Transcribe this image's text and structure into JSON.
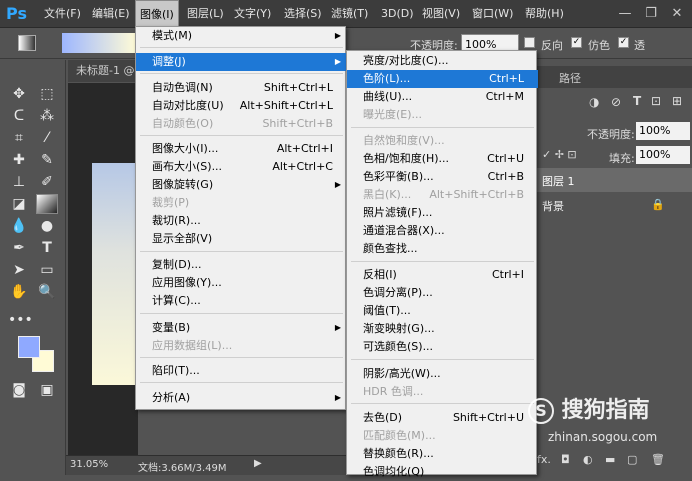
{
  "menubar": {
    "logo": "Ps",
    "items": [
      "文件(F)",
      "编辑(E)",
      "图像(I)",
      "图层(L)",
      "文字(Y)",
      "选择(S)",
      "滤镜(T)",
      "3D(D)",
      "视图(V)",
      "窗口(W)",
      "帮助(H)"
    ],
    "active_index": 2
  },
  "options": {
    "opacity_label": "不透明度:",
    "opacity_value": "100%",
    "reverse_label": "反向",
    "dither_label": "仿色",
    "transparency_label": "透"
  },
  "document": {
    "tab_title": "未标题-1 @"
  },
  "status": {
    "zoom": "31.05%",
    "doc_size": "文档:3.66M/3.49M"
  },
  "panel": {
    "tab_path": "路径",
    "opacity_label": "不透明度:",
    "opacity_value": "100%",
    "fill_label": "填充:",
    "fill_value": "100%",
    "layers": [
      "图层 1",
      "背景"
    ]
  },
  "image_menu": [
    {
      "label": "模式(M)",
      "shortcut": "",
      "disabled": false,
      "submenu": true
    },
    {
      "label": "调整(J)",
      "shortcut": "",
      "disabled": false,
      "submenu": true,
      "highlight": true
    },
    {
      "label": "自动色调(N)",
      "shortcut": "Shift+Ctrl+L",
      "disabled": false
    },
    {
      "label": "自动对比度(U)",
      "shortcut": "Alt+Shift+Ctrl+L",
      "disabled": false
    },
    {
      "label": "自动颜色(O)",
      "shortcut": "Shift+Ctrl+B",
      "disabled": true
    },
    {
      "label": "图像大小(I)...",
      "shortcut": "Alt+Ctrl+I",
      "disabled": false
    },
    {
      "label": "画布大小(S)...",
      "shortcut": "Alt+Ctrl+C",
      "disabled": false
    },
    {
      "label": "图像旋转(G)",
      "shortcut": "",
      "disabled": false,
      "submenu": true
    },
    {
      "label": "裁剪(P)",
      "shortcut": "",
      "disabled": true
    },
    {
      "label": "裁切(R)...",
      "shortcut": "",
      "disabled": false
    },
    {
      "label": "显示全部(V)",
      "shortcut": "",
      "disabled": false
    },
    {
      "label": "复制(D)...",
      "shortcut": "",
      "disabled": false
    },
    {
      "label": "应用图像(Y)...",
      "shortcut": "",
      "disabled": false
    },
    {
      "label": "计算(C)...",
      "shortcut": "",
      "disabled": false
    },
    {
      "label": "变量(B)",
      "shortcut": "",
      "disabled": false,
      "submenu": true
    },
    {
      "label": "应用数据组(L)...",
      "shortcut": "",
      "disabled": true
    },
    {
      "label": "陷印(T)...",
      "shortcut": "",
      "disabled": false
    },
    {
      "label": "分析(A)",
      "shortcut": "",
      "disabled": false,
      "submenu": true
    }
  ],
  "adjust_menu": [
    {
      "label": "亮度/对比度(C)...",
      "shortcut": "",
      "disabled": false
    },
    {
      "label": "色阶(L)...",
      "shortcut": "Ctrl+L",
      "disabled": false,
      "highlight": true
    },
    {
      "label": "曲线(U)...",
      "shortcut": "Ctrl+M",
      "disabled": false
    },
    {
      "label": "曝光度(E)...",
      "shortcut": "",
      "disabled": true
    },
    {
      "label": "自然饱和度(V)...",
      "shortcut": "",
      "disabled": true
    },
    {
      "label": "色相/饱和度(H)...",
      "shortcut": "Ctrl+U",
      "disabled": false
    },
    {
      "label": "色彩平衡(B)...",
      "shortcut": "Ctrl+B",
      "disabled": false
    },
    {
      "label": "黑白(K)...",
      "shortcut": "Alt+Shift+Ctrl+B",
      "disabled": true
    },
    {
      "label": "照片滤镜(F)...",
      "shortcut": "",
      "disabled": false
    },
    {
      "label": "通道混合器(X)...",
      "shortcut": "",
      "disabled": false
    },
    {
      "label": "颜色查找...",
      "shortcut": "",
      "disabled": false
    },
    {
      "label": "反相(I)",
      "shortcut": "Ctrl+I",
      "disabled": false
    },
    {
      "label": "色调分离(P)...",
      "shortcut": "",
      "disabled": false
    },
    {
      "label": "阈值(T)...",
      "shortcut": "",
      "disabled": false
    },
    {
      "label": "渐变映射(G)...",
      "shortcut": "",
      "disabled": false
    },
    {
      "label": "可选颜色(S)...",
      "shortcut": "",
      "disabled": false
    },
    {
      "label": "阴影/高光(W)...",
      "shortcut": "",
      "disabled": false
    },
    {
      "label": "HDR 色调...",
      "shortcut": "",
      "disabled": true
    },
    {
      "label": "去色(D)",
      "shortcut": "Shift+Ctrl+U",
      "disabled": false
    },
    {
      "label": "匹配颜色(M)...",
      "shortcut": "",
      "disabled": true
    },
    {
      "label": "替换颜色(R)...",
      "shortcut": "",
      "disabled": false
    },
    {
      "label": "色调均化(Q)",
      "shortcut": "",
      "disabled": false
    }
  ],
  "watermark": {
    "text": "搜狗指南",
    "url": "zhinan.sogou.com"
  },
  "colors": {
    "highlight": "#1e78d6",
    "foreground": "#8fa9ff",
    "background": "#fffbd6"
  }
}
